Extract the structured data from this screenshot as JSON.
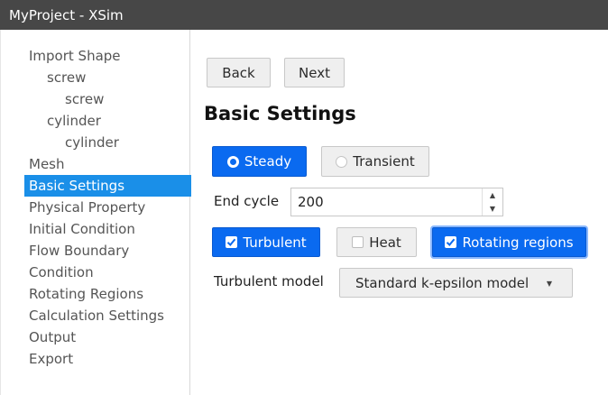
{
  "window": {
    "title": "MyProject - XSim"
  },
  "sidebar": {
    "items": [
      {
        "label": "Import Shape",
        "level": 0
      },
      {
        "label": "screw",
        "level": 1
      },
      {
        "label": "screw",
        "level": 2
      },
      {
        "label": "cylinder",
        "level": 1
      },
      {
        "label": "cylinder",
        "level": 2
      },
      {
        "label": "Mesh",
        "level": 0
      },
      {
        "label": "Basic Settings",
        "level": 0,
        "selected": true
      },
      {
        "label": "Physical Property",
        "level": 0
      },
      {
        "label": "Initial Condition",
        "level": 0
      },
      {
        "label": "Flow Boundary",
        "level": 0
      },
      {
        "label": "Condition",
        "level": 0
      },
      {
        "label": "Rotating Regions",
        "level": 0
      },
      {
        "label": "Calculation Settings",
        "level": 0
      },
      {
        "label": "Output",
        "level": 0
      },
      {
        "label": "Export",
        "level": 0
      }
    ]
  },
  "nav": {
    "back_label": "Back",
    "next_label": "Next"
  },
  "main": {
    "title": "Basic Settings",
    "time_mode": {
      "steady_label": "Steady",
      "transient_label": "Transient",
      "selected": "Steady"
    },
    "end_cycle": {
      "label": "End cycle",
      "value": "200"
    },
    "toggles": {
      "turbulent": {
        "label": "Turbulent",
        "checked": true
      },
      "heat": {
        "label": "Heat",
        "checked": false
      },
      "rotating": {
        "label": "Rotating regions",
        "checked": true
      }
    },
    "turbulent_model": {
      "label": "Turbulent model",
      "value": "Standard k-epsilon model"
    }
  },
  "colors": {
    "accent": "#0a6af0",
    "selection": "#1a8fe8",
    "titlebar": "#474747"
  },
  "icons": {
    "radio_on": "radio-selected-icon",
    "radio_off": "radio-unselected-icon",
    "check_on": "checkbox-checked-icon",
    "check_off": "checkbox-unchecked-icon",
    "spinner_up": "chevron-up-icon",
    "spinner_down": "chevron-down-icon",
    "dropdown": "caret-down-icon"
  }
}
